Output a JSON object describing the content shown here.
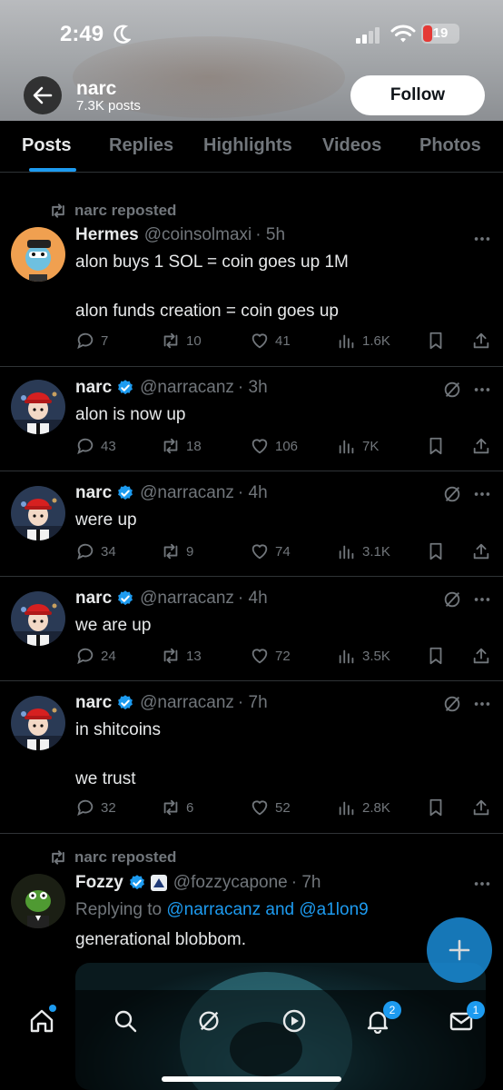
{
  "status_bar": {
    "time": "2:49",
    "battery": "19"
  },
  "header": {
    "name": "narc",
    "posts_count": "7.3K posts",
    "follow_label": "Follow"
  },
  "tabs": [
    "Posts",
    "Replies",
    "Highlights",
    "Videos",
    "Photos"
  ],
  "posts": [
    {
      "repost_label": "narc reposted",
      "name": "Hermes",
      "handle": "@coinsolmaxi",
      "time": "· 5h",
      "text_lines": [
        "alon buys 1 SOL = coin goes up 1M",
        "alon funds creation = coin goes up"
      ],
      "replies": "7",
      "reposts": "10",
      "likes": "41",
      "views": "1.6K"
    },
    {
      "name": "narc",
      "handle": "@narracanz",
      "time": "· 3h",
      "text_lines": [
        "alon is now up"
      ],
      "replies": "43",
      "reposts": "18",
      "likes": "106",
      "views": "7K"
    },
    {
      "name": "narc",
      "handle": "@narracanz",
      "time": "· 4h",
      "text_lines": [
        "were up"
      ],
      "replies": "34",
      "reposts": "9",
      "likes": "74",
      "views": "3.1K"
    },
    {
      "name": "narc",
      "handle": "@narracanz",
      "time": "· 4h",
      "text_lines": [
        "we are up"
      ],
      "replies": "24",
      "reposts": "13",
      "likes": "72",
      "views": "3.5K"
    },
    {
      "name": "narc",
      "handle": "@narracanz",
      "time": "· 7h",
      "text_lines": [
        "in shitcoins",
        "we trust"
      ],
      "replies": "32",
      "reposts": "6",
      "likes": "52",
      "views": "2.8K"
    },
    {
      "repost_label": "narc reposted",
      "name": "Fozzy",
      "handle": "@fozzycapone",
      "time": "· 7h",
      "replying_prefix": "Replying to",
      "replying_to": "@narracanz and @a1lon9",
      "text_lines": [
        "generational blobbom."
      ]
    }
  ],
  "nav_badges": {
    "notifications": "2",
    "messages": "1"
  },
  "colors": {
    "accent": "#1d9bf0",
    "verified": "#1d9bf0",
    "background": "#000000",
    "muted": "#71767b"
  }
}
